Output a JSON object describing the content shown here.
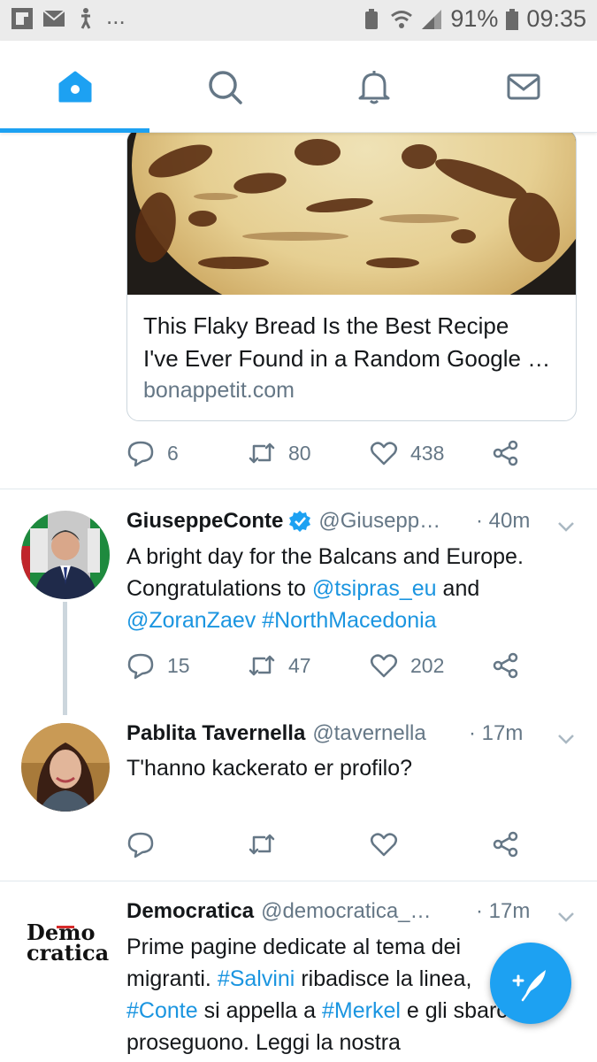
{
  "status_bar": {
    "icons_left": [
      "flipboard-icon",
      "mail-icon",
      "accessibility-icon"
    ],
    "more": "...",
    "battery_percent": "91%",
    "time": "09:35"
  },
  "tabs": [
    {
      "name": "home",
      "icon": "home-icon",
      "active": true
    },
    {
      "name": "search",
      "icon": "search-icon",
      "active": false
    },
    {
      "name": "notifications",
      "icon": "bell-icon",
      "active": false
    },
    {
      "name": "messages",
      "icon": "envelope-icon",
      "active": false
    }
  ],
  "colors": {
    "accent": "#1da1f2",
    "link": "#1b95e0",
    "muted": "#657786",
    "text": "#14171a"
  },
  "tweets": [
    {
      "card": {
        "title_line1": "This Flaky Bread Is the Best Recipe",
        "title_line2": "I've Ever Found in a Random Google …",
        "domain": "bonappetit.com"
      },
      "replies": "6",
      "retweets": "80",
      "likes": "438"
    },
    {
      "name": "GiuseppeConte",
      "handle": "@Giusepp…",
      "time": "· 40m",
      "verified": true,
      "text_line1": "A bright day for the Balcans and Europe.",
      "text_line2_a": "Congratulations to ",
      "mention1": "@tsipras_eu",
      "text_line2_b": " and",
      "mention2": "@ZoranZaev",
      "hashtag1": "#NorthMacedonia",
      "replies": "15",
      "retweets": "47",
      "likes": "202"
    },
    {
      "name": "Pablita Tavernella",
      "handle": "@tavernella",
      "time": "· 17m",
      "text": "T'hanno kackerato er profilo?",
      "replies": "",
      "retweets": "",
      "likes": ""
    },
    {
      "name": "Democratica",
      "handle": "@democratica_…",
      "time": "· 17m",
      "avatar_logo_line1": "Demo",
      "avatar_logo_line2": "cratica",
      "line1": "Prime pagine dedicate al tema dei",
      "line2_a": "migranti. ",
      "hashtag_salvini": "#Salvini",
      "line2_b": " ribadisce la linea,",
      "hashtag_conte": "#Conte",
      "line3_a": " si appella a ",
      "hashtag_merkel": "#Merkel",
      "line3_b": " e gli sbarchi",
      "line4": "proseguono. Leggi la nostra"
    }
  ]
}
